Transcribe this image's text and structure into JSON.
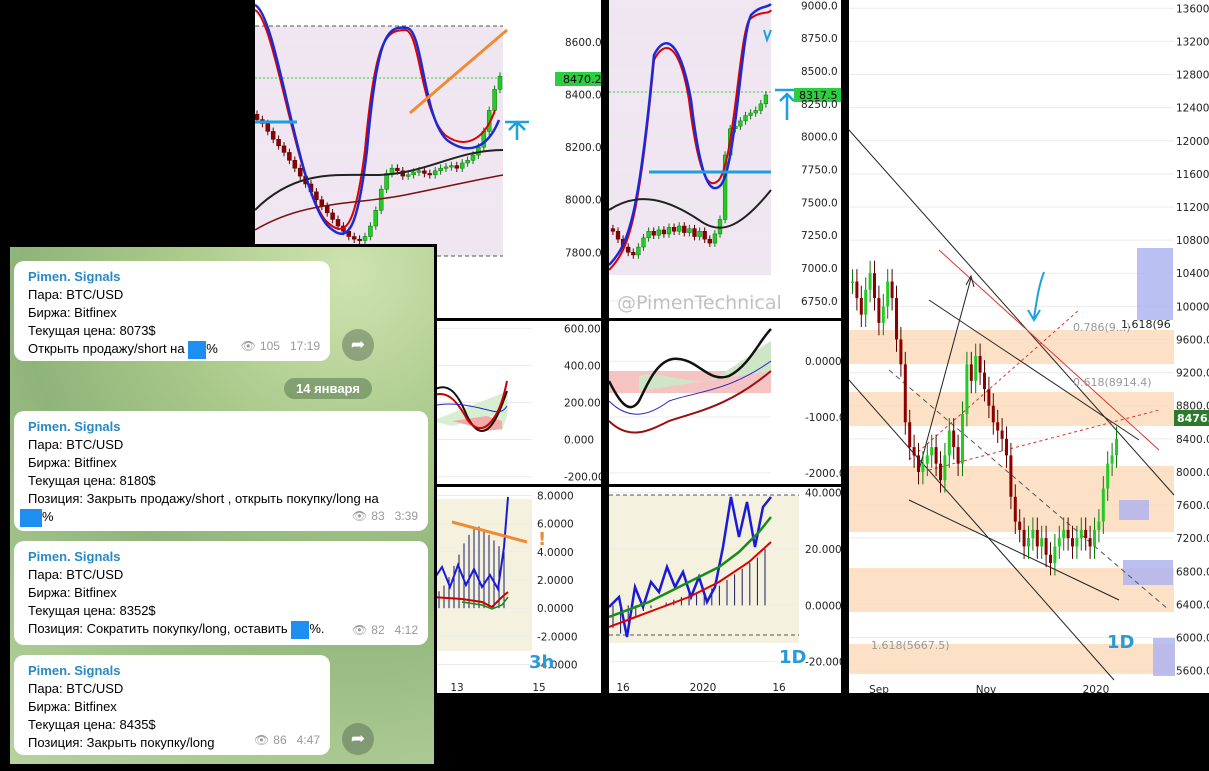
{
  "chart_data": [
    {
      "type": "candlestick",
      "title": "",
      "timeframe": "3h",
      "price_axis_ticks": [
        "8600.0",
        "8400.0",
        "8200.0",
        "8000.0",
        "7800.0"
      ],
      "last_price_label": "8470.2",
      "x_tick_labels": [
        "13",
        "15"
      ],
      "ylim": [
        7550,
        8760
      ],
      "candles_close": [
        8305,
        8290,
        8260,
        8230,
        8205,
        8180,
        8150,
        8120,
        8090,
        8060,
        8030,
        8000,
        7975,
        7950,
        7925,
        7900,
        7880,
        7860,
        7850,
        7845,
        7860,
        7900,
        7960,
        8040,
        8100,
        8120,
        8110,
        8090,
        8095,
        8105,
        8110,
        8100,
        8095,
        8110,
        8120,
        8125,
        8130,
        8120,
        8140,
        8150,
        8170,
        8200,
        8260,
        8340,
        8420,
        8470
      ]
    },
    {
      "type": "line",
      "title": "",
      "y_tick_labels": [
        "600.000",
        "400.000",
        "200.000",
        "0.000",
        "-200.000"
      ],
      "ylim": [
        -240,
        640
      ]
    },
    {
      "type": "bar",
      "title": "",
      "y_tick_labels": [
        "8.0000",
        "6.0000",
        "4.0000",
        "2.0000",
        "0.0000",
        "-2.0000",
        "-4.0000"
      ],
      "x_tick_labels": [
        "13",
        "15"
      ],
      "ylim": [
        -4.6,
        8.6
      ]
    },
    {
      "type": "candlestick",
      "title": "",
      "timeframe": "1D",
      "price_axis_ticks": [
        "9000.0",
        "8750.0",
        "8500.0",
        "8250.0",
        "8000.0",
        "7750.0",
        "7500.0",
        "7250.0",
        "7000.0",
        "6750.0"
      ],
      "last_price_label": "8317.5",
      "ylim": [
        6620,
        9040
      ],
      "watermark": "@PimenTechnical",
      "candles_close": [
        7280,
        7220,
        7160,
        7120,
        7100,
        7160,
        7230,
        7280,
        7250,
        7290,
        7260,
        7310,
        7280,
        7320,
        7270,
        7300,
        7240,
        7280,
        7220,
        7190,
        7260,
        7370,
        7860,
        8060,
        8080,
        8120,
        8160,
        8180,
        8200,
        8250,
        8317
      ]
    },
    {
      "type": "line",
      "title": "",
      "y_tick_labels": [
        "0.0000",
        "-1000.0",
        "-2000.0"
      ],
      "ylim": [
        -2200,
        720
      ]
    },
    {
      "type": "bar",
      "title": "",
      "y_tick_labels": [
        "40.0000",
        "20.0000",
        "0.0000",
        "-20.0000"
      ],
      "x_tick_labels": [
        "16",
        "2020",
        "16"
      ],
      "ylim": [
        -24,
        42
      ]
    },
    {
      "type": "candlestick",
      "title": "",
      "timeframe": "1D",
      "price_axis_ticks": [
        "13600.0",
        "13200.0",
        "12800.0",
        "12400.0",
        "12000.0",
        "11600.0",
        "11200.0",
        "10800.0",
        "10400.0",
        "10000.0",
        "9600.0",
        "9200.0",
        "8800.0",
        "8400.0",
        "8000.0",
        "7600.0",
        "7200.0",
        "6800.0",
        "6400.0",
        "6000.0",
        "5600.0"
      ],
      "last_price_label": "8476.",
      "x_tick_labels": [
        "Sep",
        "Nov",
        "2020"
      ],
      "ylim": [
        5330,
        13700
      ],
      "annotations": [
        "0.786(9...)",
        "0.618(8914.4)",
        "1.618(96",
        "1.618(5667.5)"
      ]
    }
  ],
  "telegram": {
    "date_separator": "14 января",
    "messages": [
      {
        "sender": "Pimen. Signals",
        "line1": "Пара: BTC/USD",
        "line2": "Биржа: Bitfinex",
        "line3": "Текущая цена: 8073$",
        "line4a": "Открыть продажу/short на ",
        "line4b": "%",
        "views": "105",
        "time": "17:19"
      },
      {
        "sender": "Pimen. Signals",
        "line1": "Пара: BTC/USD",
        "line2": "Биржа: Bitfinex",
        "line3": "Текущая цена: 8180$",
        "line4a": "Позиция:   Закрыть  продажу/short , открыть покупку/long на",
        "line4b": "%",
        "views": "83",
        "time": "3:39"
      },
      {
        "sender": "Pimen. Signals",
        "line1": "Пара: BTC/USD",
        "line2": "Биржа: Bitfinex",
        "line3": "Текущая цена: 8352$",
        "line4a": "Позиция:   Сократить покупку/long,  оставить ",
        "line4b": "%.",
        "views": "82",
        "time": "4:12"
      },
      {
        "sender": "Pimen. Signals",
        "line1": "Пара: BTC/USD",
        "line2": "Биржа: Bitfinex",
        "line3": "Текущая цена: 8435$",
        "line4a": "Позиция:    Закрыть покупку/long",
        "line4b": "",
        "views": "86",
        "time": "4:47"
      }
    ]
  },
  "colors": {
    "accent_blue": "#1e8ff0",
    "bull_candle": "#22cc22",
    "bear_candle": "#8b0000",
    "telegram_sender": "#2a89c4",
    "timeframe_label": "#2a9ad6"
  },
  "icons": [
    "eye-icon",
    "share-icon"
  ]
}
